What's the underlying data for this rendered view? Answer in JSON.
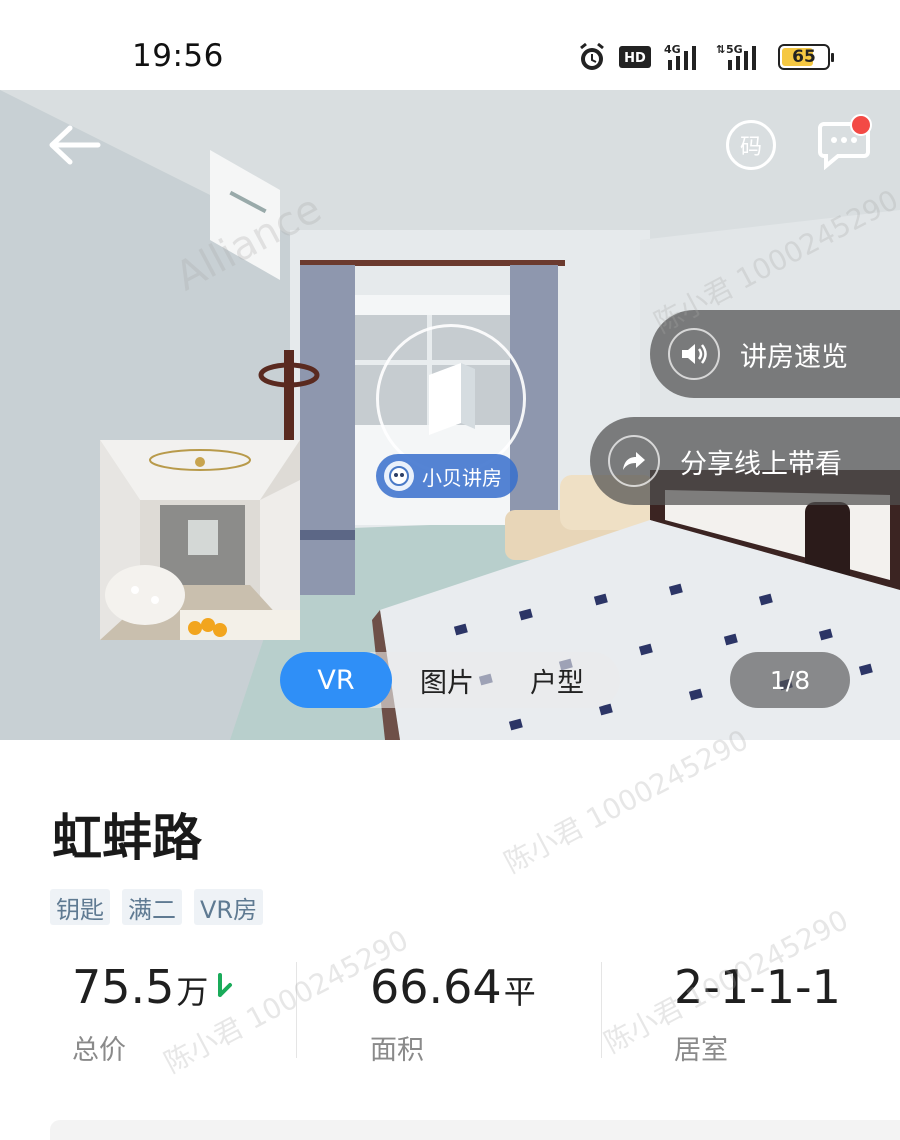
{
  "status_bar": {
    "time": "19:56",
    "hd_label": "HD",
    "net1_label": "4G",
    "net2_label": "5G",
    "battery": "65",
    "battery_level": 0.65
  },
  "header": {
    "qr_label": "码",
    "icons": [
      "back-arrow-icon",
      "qr-code-icon",
      "message-icon"
    ]
  },
  "gallery": {
    "audio_tour_label": "讲房速览",
    "share_label": "分享线上带看",
    "guide_label": "小贝讲房",
    "tabs": [
      "VR",
      "图片",
      "户型"
    ],
    "active_tab": "VR",
    "counter": "1/8"
  },
  "listing": {
    "title": "虹蚌路",
    "tags": [
      "钥匙",
      "满二",
      "VR房"
    ],
    "price": {
      "value": "75.5",
      "unit": "万",
      "label": "总价",
      "trend": "down"
    },
    "area": {
      "value": "66.64",
      "unit": "平",
      "label": "面积"
    },
    "rooms": {
      "value": "2-1-1-1",
      "label": "居室"
    }
  },
  "watermarks": [
    "陈小君 1000245290",
    "Alliance"
  ],
  "colors": {
    "accent": "#2f8ff7",
    "notification": "#f34a45",
    "tag_bg": "#eef2f6",
    "tag_text": "#5f7a92",
    "trend_down": "#1aab5a"
  }
}
